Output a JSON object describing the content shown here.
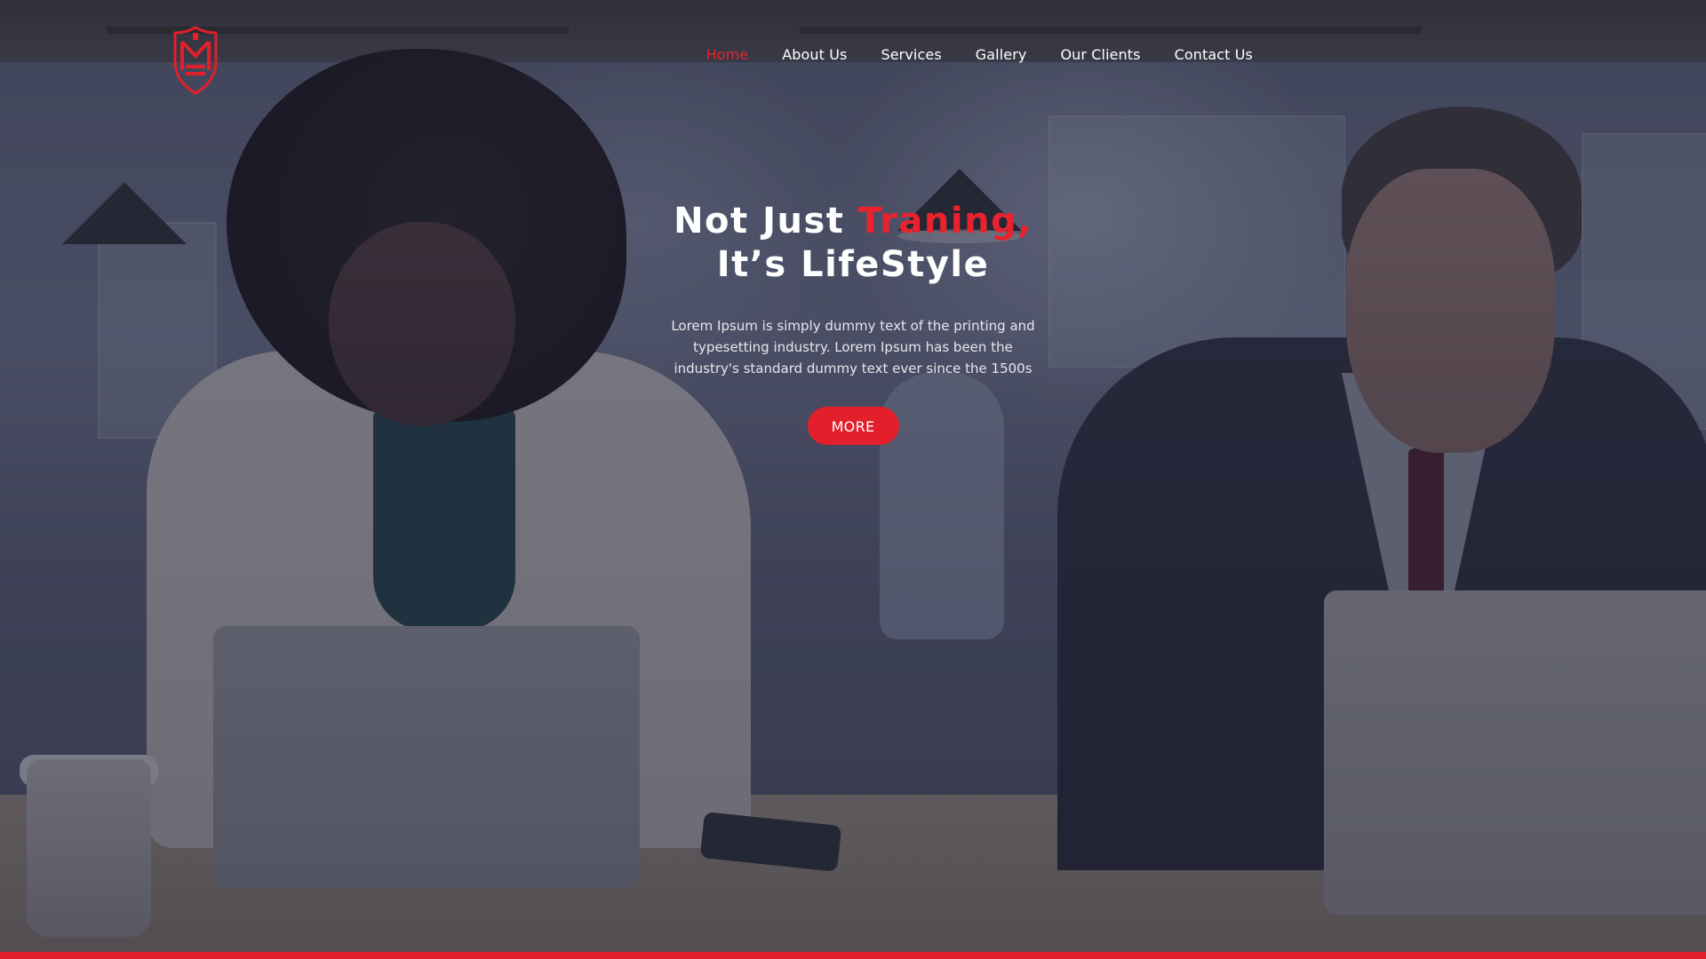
{
  "nav": {
    "items": [
      {
        "label": "Home",
        "active": true
      },
      {
        "label": "About Us",
        "active": false
      },
      {
        "label": "Services",
        "active": false
      },
      {
        "label": "Gallery",
        "active": false
      },
      {
        "label": "Our Clients",
        "active": false
      },
      {
        "label": "Contact Us",
        "active": false
      }
    ]
  },
  "hero": {
    "title_part1": "Not Just ",
    "title_accent": "Traning,",
    "title_line2": "It’s LifeStyle",
    "description": "Lorem Ipsum is simply dummy text of the printing and typesetting industry. Lorem Ipsum has been the industry's standard dummy text ever since the 1500s",
    "button_label": "MORE"
  },
  "colors": {
    "accent": "#e21f2a",
    "nav_active": "#e8232e",
    "text": "#ffffff"
  },
  "icons": {
    "logo": "shield-crest-logo"
  }
}
